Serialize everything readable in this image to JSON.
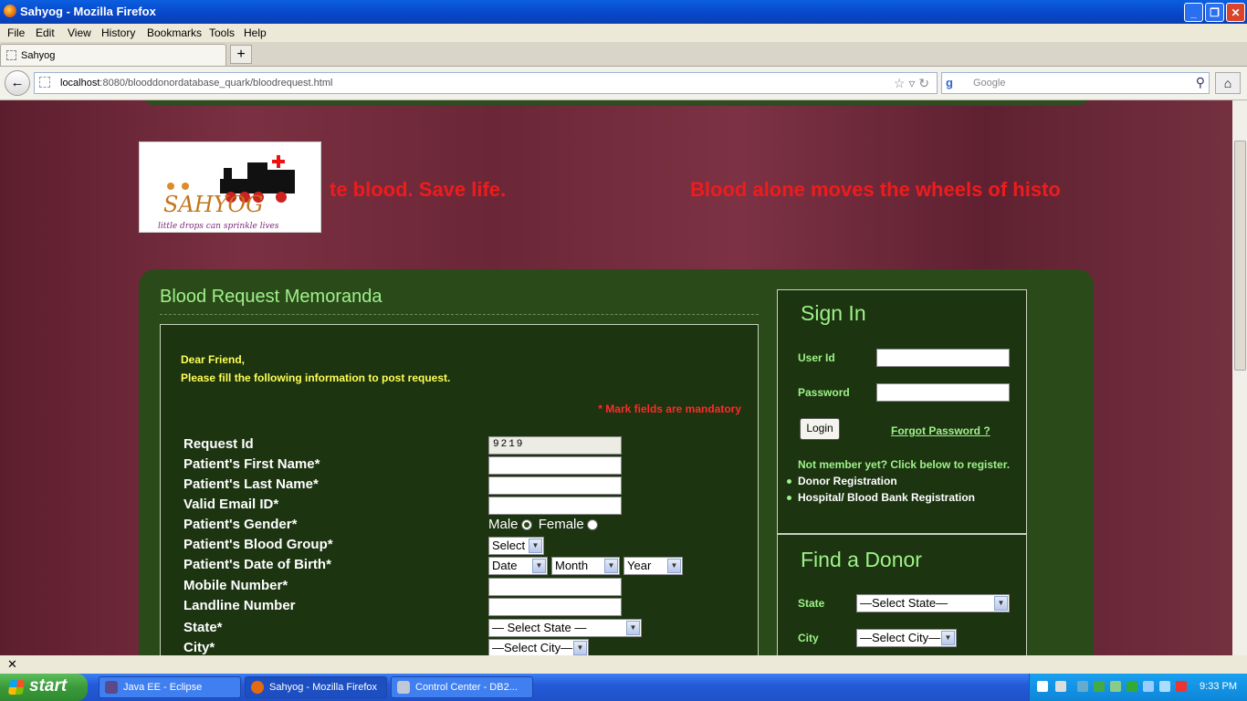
{
  "window": {
    "title": "Sahyog - Mozilla Firefox",
    "min": "_",
    "max": "❐",
    "close": "✕"
  },
  "menu": [
    "File",
    "Edit",
    "View",
    "History",
    "Bookmarks",
    "Tools",
    "Help"
  ],
  "tab": {
    "label": "Sahyog",
    "new_tab": "+"
  },
  "nav": {
    "back": "←",
    "url_host": "localhost",
    "url_rest": ":8080/blooddonordatabase_quark/bloodrequest.html",
    "url_icons": "☆ ▿ ↻",
    "search_engine": "g",
    "search_placeholder": "Google",
    "search_icon": "⚲",
    "home": "⌂"
  },
  "banner": {
    "marquee_1": "te blood. Save life.",
    "marquee_2": "Blood alone moves the wheels of histo"
  },
  "logo": {
    "tagline": "little drops can sprinkle lives",
    "word": "SAHYOG",
    "cross": "+"
  },
  "form": {
    "heading": "Blood Request Memoranda",
    "greeting_line1": "Dear Friend,",
    "greeting_line2": "Please fill the following information to post request.",
    "mandatory_note": "* Mark fields are mandatory",
    "fields": [
      {
        "label": "Request Id",
        "value": "9219"
      },
      {
        "label": "Patient's First Name*",
        "value": ""
      },
      {
        "label": "Patient's Last Name*",
        "value": ""
      },
      {
        "label": "Valid Email ID*",
        "value": ""
      },
      {
        "label": "Patient's Gender*"
      },
      {
        "label": "Patient's Blood Group*"
      },
      {
        "label": "Patient's Date of Birth*"
      },
      {
        "label": "Mobile Number*",
        "value": ""
      },
      {
        "label": "Landline Number",
        "value": ""
      },
      {
        "label": "State*"
      },
      {
        "label": "City*"
      }
    ],
    "gender": {
      "male": "Male",
      "female": "Female",
      "selected": "Male"
    },
    "blood_group_selected": "Select",
    "dob": {
      "date": "Date",
      "month": "Month",
      "year": "Year"
    },
    "state_selected": "— Select State —",
    "city_selected": "—Select City—"
  },
  "signin": {
    "heading": "Sign In",
    "user_label": "User Id",
    "password_label": "Password",
    "login_button": "Login",
    "forgot_link": "Forgot Password ?",
    "not_member": "Not member yet? Click below to register.",
    "links": [
      "Donor Registration",
      "Hospital/ Blood Bank Registration"
    ]
  },
  "find_donor": {
    "heading": "Find a Donor",
    "state_label": "State",
    "state_selected": "—Select State—",
    "city_label": "City",
    "city_selected": "—Select City—"
  },
  "statusbar": {
    "close": "✕"
  },
  "taskbar": {
    "start": "start",
    "tasks": [
      "Java EE - Eclipse",
      "Sahyog - Mozilla Firefox",
      "Control Center - DB2..."
    ],
    "clock": "9:33 PM"
  },
  "colors": {
    "accent_green": "#9ff28a",
    "panel": "#2b4a1a",
    "red": "#ee1c1c",
    "yellow": "#ffff55"
  }
}
